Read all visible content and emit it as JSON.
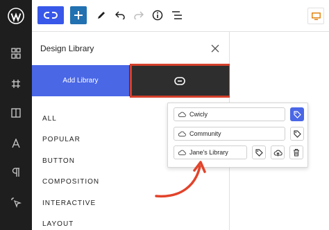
{
  "panel": {
    "title": "Design Library",
    "add_library_label": "Add Library",
    "categories": [
      "ALL",
      "POPULAR",
      "BUTTON",
      "COMPOSITION",
      "INTERACTIVE",
      "LAYOUT"
    ]
  },
  "libraries": [
    {
      "name": "Cwicly",
      "tag_active": true
    },
    {
      "name": "Community",
      "tag_active": false
    },
    {
      "name": "Jane's Library",
      "tag_active": false
    }
  ],
  "colors": {
    "accent": "#4a67e6",
    "highlight_border": "#d5402b",
    "rail": "#1e1e1e"
  }
}
